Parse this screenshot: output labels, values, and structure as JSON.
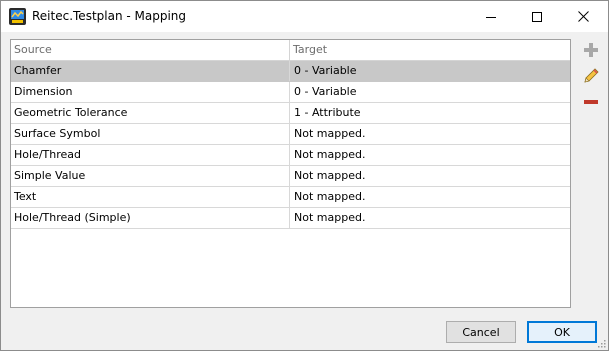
{
  "window": {
    "title": "Reitec.Testplan - Mapping"
  },
  "grid": {
    "columns": [
      "Source",
      "Target"
    ],
    "rows": [
      {
        "source": "Chamfer",
        "target": "0 - Variable",
        "selected": true
      },
      {
        "source": "Dimension",
        "target": "0 - Variable"
      },
      {
        "source": "Geometric Tolerance",
        "target": "1 - Attribute"
      },
      {
        "source": "Surface Symbol",
        "target": "Not mapped."
      },
      {
        "source": "Hole/Thread",
        "target": "Not mapped."
      },
      {
        "source": "Simple Value",
        "target": "Not mapped."
      },
      {
        "source": "Text",
        "target": "Not mapped."
      },
      {
        "source": "Hole/Thread (Simple)",
        "target": "Not mapped."
      }
    ]
  },
  "side_toolbar": {
    "icons": [
      "plus-icon",
      "pencil-icon",
      "minus-icon"
    ]
  },
  "footer": {
    "cancel_label": "Cancel",
    "ok_label": "OK"
  },
  "colors": {
    "selected_row": "#c8c8c8",
    "ok_border": "#0078d7",
    "remove_red": "#c0392b"
  }
}
